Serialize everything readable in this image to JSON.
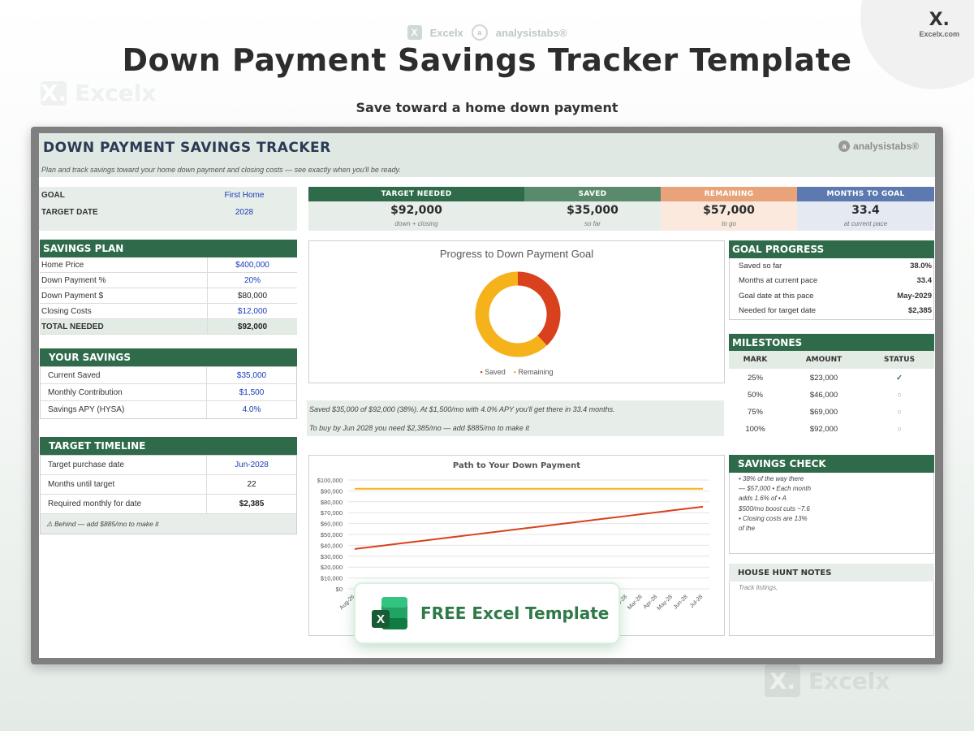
{
  "page": {
    "title": "Down Payment Savings Tracker Template",
    "subtitle": "Save toward a home down payment",
    "brand_excelx": "Excelx",
    "brand_analysistabs": "analysistabs®",
    "corner_logo": "X.",
    "corner_url": "Excelx.com"
  },
  "sheet": {
    "title": "DOWN PAYMENT SAVINGS TRACKER",
    "description": "Plan and track savings toward your home down payment and closing costs — see exactly when you'll be ready.",
    "brand": "analysistabs®"
  },
  "goal": {
    "goal_label": "GOAL",
    "goal_value": "First Home",
    "date_label": "TARGET DATE",
    "date_value": "2028"
  },
  "kpis": [
    {
      "header": "TARGET NEEDED",
      "value": "$92,000",
      "sub": "down + closing",
      "color": "#2f6b4b",
      "bg": "#e7eee9"
    },
    {
      "header": "SAVED",
      "value": "$35,000",
      "sub": "so far",
      "color": "#5a8a6c",
      "bg": "#e7eee9"
    },
    {
      "header": "REMAINING",
      "value": "$57,000",
      "sub": "to go",
      "color": "#e8a37a",
      "bg": "#fbe9de"
    },
    {
      "header": "MONTHS TO GOAL",
      "value": "33.4",
      "sub": "at current pace",
      "color": "#5c7ab0",
      "bg": "#e4e9f2"
    }
  ],
  "savings_plan": {
    "header": "SAVINGS PLAN",
    "rows": [
      {
        "label": "Home Price",
        "value": "$400,000"
      },
      {
        "label": "Down Payment %",
        "value": "20%"
      },
      {
        "label": "Down Payment $",
        "value": "$80,000"
      },
      {
        "label": "Closing Costs",
        "value": "$12,000"
      }
    ],
    "total_label": "TOTAL NEEDED",
    "total_value": "$92,000"
  },
  "your_savings": {
    "header": "YOUR SAVINGS",
    "rows": [
      {
        "label": "Current Saved",
        "value": "$35,000"
      },
      {
        "label": "Monthly Contribution",
        "value": "$1,500"
      },
      {
        "label": "Savings APY (HYSA)",
        "value": "4.0%"
      }
    ]
  },
  "target_timeline": {
    "header": "TARGET TIMELINE",
    "rows": [
      {
        "label": "Target purchase date",
        "value": "Jun-2028"
      },
      {
        "label": "Months until target",
        "value": "22"
      },
      {
        "label": "Required monthly for date",
        "value": "$2,385"
      }
    ],
    "warning": "⚠ Behind — add $885/mo to make it"
  },
  "donut": {
    "title": "Progress to Down Payment Goal",
    "legend_saved": "Saved",
    "legend_remaining": "Remaining",
    "colors": {
      "saved": "#d9411e",
      "remaining": "#f5b21b"
    }
  },
  "notes": {
    "line1": "Saved $35,000 of $92,000 (38%). At $1,500/mo with 4.0% APY you'll get there in 33.4 months.",
    "line2": "To buy by Jun 2028 you need $2,385/mo — add $885/mo to make it"
  },
  "goal_progress": {
    "header": "GOAL PROGRESS",
    "rows": [
      {
        "label": "Saved so far",
        "value": "38.0%"
      },
      {
        "label": "Months at current pace",
        "value": "33.4"
      },
      {
        "label": "Goal date at this pace",
        "value": "May-2029"
      },
      {
        "label": "Needed for target date",
        "value": "$2,385"
      }
    ]
  },
  "milestones": {
    "header": "MILESTONES",
    "columns": [
      "MARK",
      "AMOUNT",
      "STATUS"
    ],
    "rows": [
      {
        "mark": "25%",
        "amount": "$23,000",
        "status": "✓"
      },
      {
        "mark": "50%",
        "amount": "$46,000",
        "status": "○"
      },
      {
        "mark": "75%",
        "amount": "$69,000",
        "status": "○"
      },
      {
        "mark": "100%",
        "amount": "$92,000",
        "status": "○"
      }
    ]
  },
  "savings_check": {
    "header": "SAVINGS CHECK",
    "text": "• 38% of the way there — $57,000 • Each month adds 1.6% of • A $500/mo boost cuts ~7.6 • Closing costs are 13% of the"
  },
  "house_hunt": {
    "header": "HOUSE HUNT NOTES",
    "placeholder": "Track listings,"
  },
  "promo": {
    "label": "FREE Excel Template"
  },
  "chart_data": [
    {
      "type": "pie",
      "title": "Progress to Down Payment Goal",
      "labels": [
        "Saved",
        "Remaining"
      ],
      "values": [
        35000,
        57000
      ]
    },
    {
      "type": "line",
      "title": "Path to Your Down Payment",
      "x": [
        "Aug-26",
        "Sep-26",
        "Oct-26",
        "Nov-26",
        "Dec-26",
        "Jan-27",
        "Feb-27",
        "Mar-27",
        "Apr-27",
        "May-27",
        "Jun-27",
        "Jul-27",
        "Aug-27",
        "Sep-27",
        "Oct-27",
        "Nov-27",
        "Dec-27",
        "Jan-28",
        "Feb-28",
        "Mar-28",
        "Apr-28",
        "May-28",
        "Jun-28",
        "Jul-28"
      ],
      "x_ticks_shown": [
        "Aug-26",
        "Feb-28",
        "Mar-28",
        "Apr-28",
        "May-28",
        "Jun-28",
        "Jul-28"
      ],
      "yticks": [
        "$0",
        "$10,000",
        "$20,000",
        "$30,000",
        "$40,000",
        "$50,000",
        "$60,000",
        "$70,000",
        "$80,000",
        "$90,000",
        "$100,000"
      ],
      "ylim": [
        0,
        100000
      ],
      "series": [
        {
          "color": "#d9411e",
          "values": [
            36620,
            38240,
            39860,
            41480,
            43100,
            44720,
            46340,
            47960,
            49580,
            51200,
            52820,
            54440,
            56060,
            57680,
            59300,
            60920,
            62540,
            64160,
            65780,
            67400,
            69020,
            70640,
            72260,
            73880,
            75500
          ]
        },
        {
          "color": "#f5b21b",
          "values": [
            92000,
            92000
          ]
        }
      ]
    }
  ]
}
